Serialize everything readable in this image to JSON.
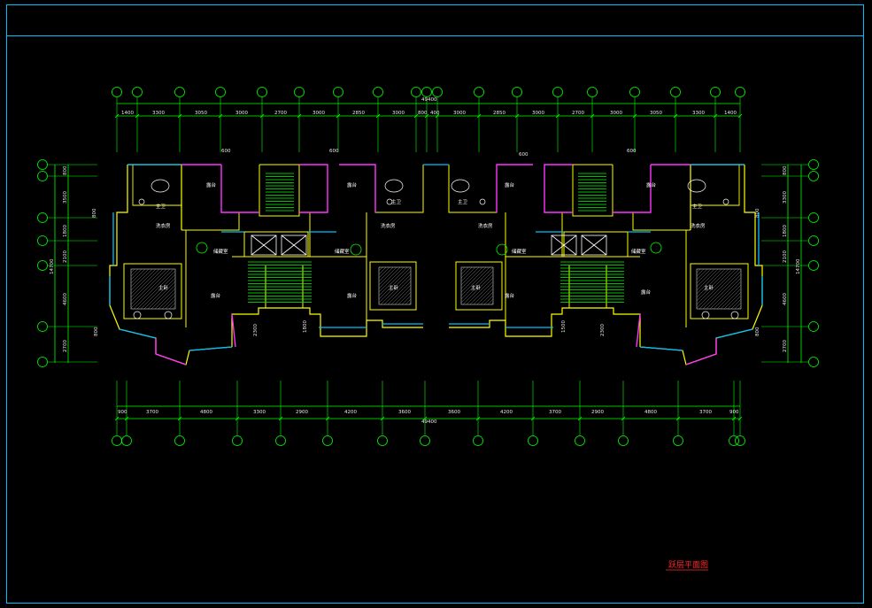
{
  "drawing": {
    "title": "跃层平面图",
    "overall_dimension_top": "49400",
    "overall_dimension_bottom": "49400",
    "left_total_dimension": "14700",
    "right_total_dimension": "14700"
  },
  "top_dimensions": [
    "1400",
    "3300",
    "3050",
    "3000",
    "2700",
    "3000",
    "2850",
    "3000",
    "800",
    "400",
    "3000",
    "2850",
    "3000",
    "2700",
    "3000",
    "3050",
    "3300",
    "1400"
  ],
  "bottom_dimensions": [
    "900",
    "3700",
    "4800",
    "3300",
    "2900",
    "4200",
    "3600",
    "3600",
    "4200",
    "3700",
    "2900",
    "4800",
    "3700",
    "900"
  ],
  "left_dimensions": [
    "800",
    "3500",
    "1800",
    "2100",
    "4600",
    "2700"
  ],
  "right_dimensions": [
    "800",
    "3300",
    "1800",
    "2100",
    "4600",
    "2700"
  ],
  "small_dimensions": [
    "600",
    "600",
    "600",
    "600",
    "800",
    "800",
    "2300",
    "1800",
    "1500",
    "2300",
    "800",
    "800"
  ],
  "room_labels": {
    "balcony": "露台",
    "master_bedroom": "主卧",
    "laundry": "洗衣房",
    "storage": "储藏室",
    "master_bath": "主卫"
  },
  "colors": {
    "background": "#000000",
    "frame": "#00bfff",
    "axis": "#00ff00",
    "wall": "#ffff00",
    "window": "#00bfff",
    "partition": "#ff33ff",
    "fixture": "#ffffff",
    "title": "#ff2a2a",
    "door": "#ffffff"
  }
}
